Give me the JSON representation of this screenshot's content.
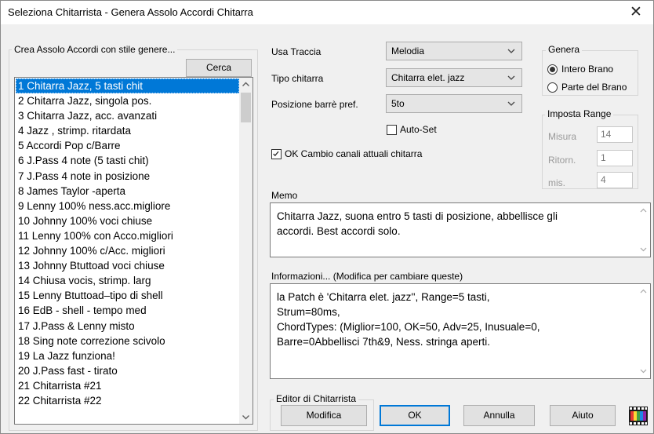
{
  "window": {
    "title": "Seleziona Chitarrista - Genera Assolo Accordi Chitarra",
    "close_glyph": "✕"
  },
  "left_group": {
    "legend": "Crea Assolo Accordi con stile genere...",
    "search_label": "Cerca",
    "items": [
      "1 Chitarra Jazz, 5 tasti chit",
      "2 Chitarra Jazz, singola pos.",
      "3 Chitarra Jazz, acc. avanzati",
      "4 Jazz , strimp. ritardata",
      "5 Accordi Pop c/Barre",
      "6 J.Pass 4 note (5 tasti chit)",
      "7 J.Pass 4 note in posizione",
      "8 James Taylor -aperta",
      "9 Lenny 100% ness.acc.migliore",
      "10 Johnny 100% voci chiuse",
      "11 Lenny 100% con Acco.migliori",
      "12 Johnny 100% c/Acc. migliori",
      "13 Johnny Btuttoad voci chiuse",
      "14 Chiusa vocis, strimp. larg",
      "15 Lenny Btuttoad–tipo di shell",
      "16 EdB - shell - tempo med",
      "17 J.Pass & Lenny misto",
      "18 Sing note correzione scivolo",
      "19 La Jazz funziona!",
      "20 J.Pass fast - tirato",
      "21 Chitarrista #21",
      "22 Chitarrista #22"
    ],
    "selected_index": 0
  },
  "settings": {
    "usa_traccia_label": "Usa Traccia",
    "usa_traccia_value": "Melodia",
    "tipo_chitarra_label": "Tipo chitarra",
    "tipo_chitarra_value": "Chitarra elet. jazz",
    "posizione_label": "Posizione barrè pref.",
    "posizione_value": "5to",
    "auto_set_label": "Auto-Set",
    "auto_set_checked": false,
    "ok_cambio_label": "OK Cambio canali attuali chitarra",
    "ok_cambio_checked": true
  },
  "genera": {
    "legend": "Genera",
    "option_intero": "Intero Brano",
    "option_parte": "Parte del Brano",
    "selected": "Intero Brano"
  },
  "range": {
    "legend": "Imposta Range",
    "misura_label": "Misura",
    "misura_value": "14",
    "ritorn_label": "Ritorn.",
    "ritorn_value": "1",
    "mis_label": "mis.",
    "mis_value": "4"
  },
  "memo": {
    "label": "Memo",
    "text": "Chitarra Jazz, suona entro 5 tasti di posizione, abbellisce gli\naccordi. Best accordi solo."
  },
  "info": {
    "label": "Informazioni... (Modifica per cambiare queste)",
    "text": "la Patch è 'Chitarra elet. jazz'', Range=5 tasti,\nStrum=80ms,\nChordTypes: (Miglior=100, OK=50, Adv=25, Inusuale=0,\nBarre=0Abbellisci 7th&9, Ness. stringa aperti."
  },
  "editor": {
    "legend": "Editor di Chitarrista",
    "modifica_label": "Modifica"
  },
  "buttons": {
    "ok": "OK",
    "annulla": "Annulla",
    "aiuto": "Aiuto"
  },
  "colors": {
    "selection": "#0078d7",
    "accent_border": "#0078d7"
  },
  "icons": {
    "film": "film-strip-icon"
  }
}
